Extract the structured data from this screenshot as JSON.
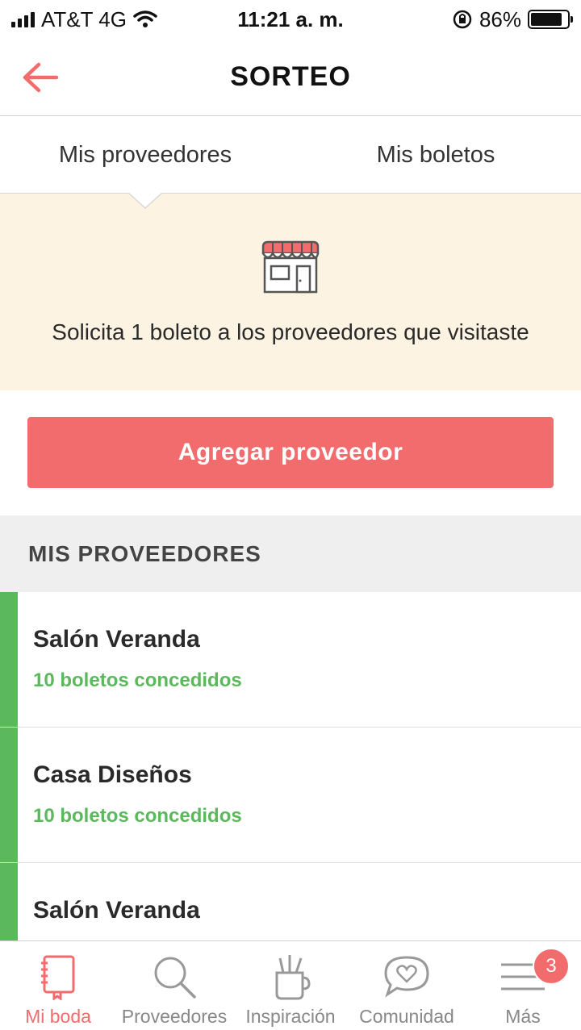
{
  "status_bar": {
    "carrier": "AT&T 4G",
    "time": "11:21 a. m.",
    "battery": "86%",
    "battery_level": 0.86
  },
  "header": {
    "title": "SORTEO",
    "back_icon": "arrow-left-icon"
  },
  "tabs": [
    {
      "label": "Mis proveedores",
      "active": true
    },
    {
      "label": "Mis boletos",
      "active": false
    }
  ],
  "promo": {
    "icon": "store-icon",
    "text": "Solicita 1 boleto a los proveedores que visitaste"
  },
  "add_button": {
    "label": "Agregar proveedor"
  },
  "section": {
    "title": "MIS PROVEEDORES"
  },
  "providers": [
    {
      "name": "Salón Veranda",
      "status": "10 boletos concedidos"
    },
    {
      "name": "Casa Diseños",
      "status": "10 boletos concedidos"
    },
    {
      "name": "Salón Veranda",
      "status": ""
    }
  ],
  "bottom_nav": [
    {
      "label": "Mi boda",
      "icon": "notebook-icon",
      "active": true
    },
    {
      "label": "Proveedores",
      "icon": "search-icon",
      "active": false
    },
    {
      "label": "Inspiración",
      "icon": "pencil-cup-icon",
      "active": false
    },
    {
      "label": "Comunidad",
      "icon": "chat-heart-icon",
      "active": false
    },
    {
      "label": "Más",
      "icon": "menu-icon",
      "active": false,
      "badge": "3"
    }
  ],
  "colors": {
    "accent": "#f36c6d",
    "success": "#5cb85c",
    "promo_bg": "#fcf3e3",
    "section_bg": "#efefef"
  }
}
